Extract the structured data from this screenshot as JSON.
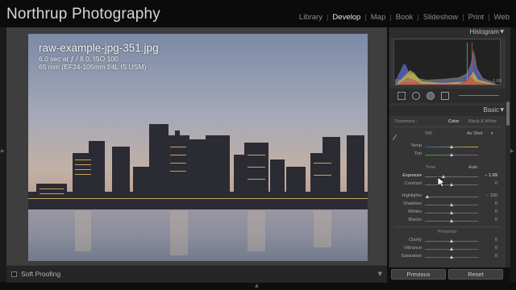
{
  "app": {
    "brand": "Northrup Photography",
    "modules": [
      {
        "label": "Library",
        "active": false
      },
      {
        "label": "Develop",
        "active": true
      },
      {
        "label": "Map",
        "active": false
      },
      {
        "label": "Book",
        "active": false
      },
      {
        "label": "Slideshow",
        "active": false
      },
      {
        "label": "Print",
        "active": false
      },
      {
        "label": "Web",
        "active": false
      }
    ]
  },
  "photo_info": {
    "filename": "raw-example-jpg-351.jpg",
    "exposure": "6.0 sec at ƒ / 8.0, ISO 100",
    "lens": "65 mm (EF24-105mm f/4L IS USM)"
  },
  "toolbar": {
    "soft_proofing": "Soft Proofing"
  },
  "histogram": {
    "title": "Histogram",
    "hover_label": "Exposure",
    "hover_value": "-1.69"
  },
  "basic": {
    "title": "Basic",
    "treatment_label": "Treatment :",
    "color_label": "Color",
    "bw_label": "Black & White",
    "wb_label": "WB :",
    "wb_value": "As Shot",
    "temp_label": "Temp",
    "tint_label": "Tint",
    "tone_label": "Tone",
    "auto_label": "Auto",
    "exposure_label": "Exposure",
    "exposure_value": "− 1.69",
    "exposure_level": -1.69,
    "contrast_label": "Contrast",
    "contrast_value": "0",
    "highlights_label": "Highlights",
    "highlights_value": "− 100",
    "shadows_label": "Shadows",
    "shadows_value": "0",
    "whites_label": "Whites",
    "whites_value": "0",
    "blacks_label": "Blacks",
    "blacks_value": "0",
    "presence_label": "Presence",
    "clarity_label": "Clarity",
    "clarity_value": "0",
    "vibrance_label": "Vibrance",
    "vibrance_value": "0",
    "saturation_label": "Saturation",
    "saturation_value": "0"
  },
  "buttons": {
    "previous": "Previous",
    "reset": "Reset"
  }
}
